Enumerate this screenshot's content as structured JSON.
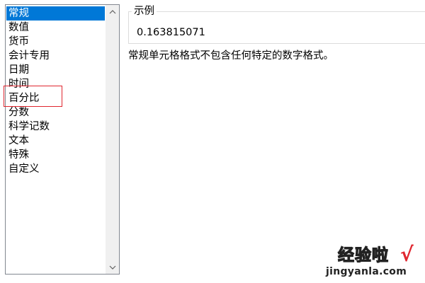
{
  "category_list": {
    "items": [
      {
        "label": "常规",
        "selected": true
      },
      {
        "label": "数值",
        "selected": false
      },
      {
        "label": "货币",
        "selected": false
      },
      {
        "label": "会计专用",
        "selected": false
      },
      {
        "label": "日期",
        "selected": false
      },
      {
        "label": "时间",
        "selected": false
      },
      {
        "label": "百分比",
        "selected": false
      },
      {
        "label": "分数",
        "selected": false
      },
      {
        "label": "科学记数",
        "selected": false
      },
      {
        "label": "文本",
        "selected": false
      },
      {
        "label": "特殊",
        "selected": false
      },
      {
        "label": "自定义",
        "selected": false
      }
    ],
    "highlighted_item": "百分比",
    "scroll_up_icon": "chevron-up-icon",
    "scroll_down_icon": "chevron-down-icon"
  },
  "sample": {
    "legend": "示例",
    "value": "0.163815071"
  },
  "description": "常规单元格格式不包含任何特定的数字格式。",
  "watermark": {
    "title": "经验啦",
    "check": "√",
    "url": "jingyanla.com"
  },
  "colors": {
    "selection": "#0078d7",
    "highlight_border": "#e0262f",
    "list_border": "#828790",
    "scrollbar_track": "#f0f0f0"
  }
}
